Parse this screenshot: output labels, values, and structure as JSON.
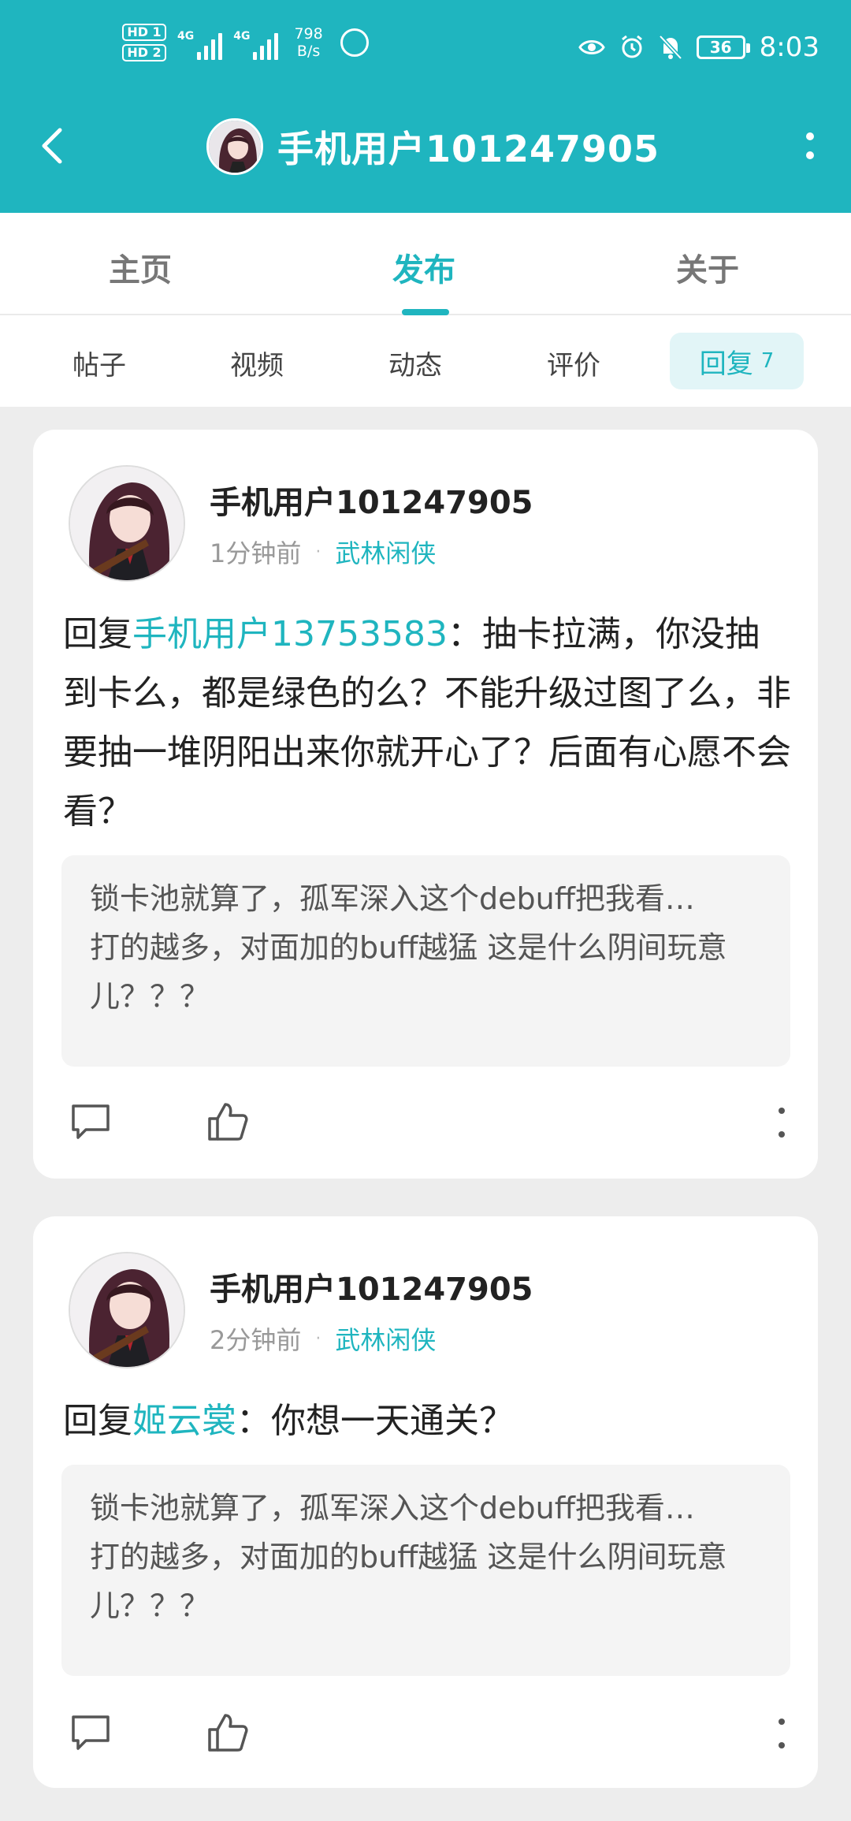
{
  "status_bar": {
    "hd1": "HD 1",
    "hd2": "HD 2",
    "sig1_tag": "4G",
    "sig2_tag": "4G",
    "net_speed_value": "798",
    "net_speed_unit": "B/s",
    "battery": "36",
    "time": "8:03"
  },
  "header": {
    "title": "手机用户101247905",
    "accent_color": "#1fb5bf"
  },
  "tabs": [
    {
      "label": "主页"
    },
    {
      "label": "发布"
    },
    {
      "label": "关于"
    }
  ],
  "subtabs": [
    {
      "label": "帖子"
    },
    {
      "label": "视频"
    },
    {
      "label": "动态"
    },
    {
      "label": "评价"
    },
    {
      "label": "回复",
      "count": "7"
    }
  ],
  "posts": [
    {
      "username": "手机用户101247905",
      "time": "1分钟前",
      "separator": "·",
      "badge": "武林闲侠",
      "reply_prefix": "回复",
      "mention": "手机用户13753583",
      "reply_body": "：抽卡拉满，你没抽到卡么，都是绿色的么？不能升级过图了么，非要抽一堆阴阳出来你就开心了？后面有心愿不会看？",
      "quote_line1": "锁卡池就算了，孤军深入这个debuff把我看…",
      "quote_line2": "打的越多，对面加的buff越猛 这是什么阴间玩意儿？？？"
    },
    {
      "username": "手机用户101247905",
      "time": "2分钟前",
      "separator": "·",
      "badge": "武林闲侠",
      "reply_prefix": "回复",
      "mention": "姬云裳",
      "reply_body": "：你想一天通关？",
      "quote_line1": "锁卡池就算了，孤军深入这个debuff把我看…",
      "quote_line2": "打的越多，对面加的buff越猛 这是什么阴间玩意儿？？？"
    }
  ]
}
